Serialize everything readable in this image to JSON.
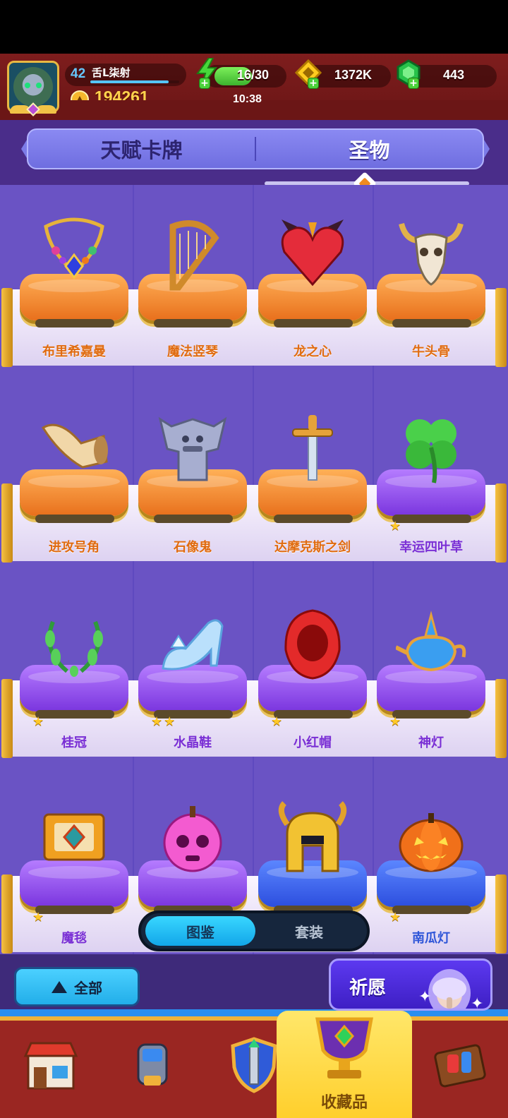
{
  "player": {
    "level": "42",
    "name": "舌L柒射",
    "xp_fraction": 0.88,
    "trophies": "194261"
  },
  "resources": {
    "energy": "16/30",
    "energy_fraction": 0.53,
    "energy_timer": "10:38",
    "gold": "1372K",
    "gems": "443"
  },
  "tabs": {
    "talent": "天赋卡牌",
    "relic": "圣物"
  },
  "relics": [
    {
      "name": "布里希嘉曼",
      "rarity": "orange",
      "stars": 0,
      "icon": "necklace-icon"
    },
    {
      "name": "魔法竖琴",
      "rarity": "orange",
      "stars": 0,
      "icon": "harp-icon"
    },
    {
      "name": "龙之心",
      "rarity": "orange",
      "stars": 0,
      "icon": "heart-icon"
    },
    {
      "name": "牛头骨",
      "rarity": "orange",
      "stars": 0,
      "icon": "bull-skull-icon"
    },
    {
      "name": "进攻号角",
      "rarity": "orange",
      "stars": 0,
      "icon": "horn-icon"
    },
    {
      "name": "石像鬼",
      "rarity": "orange",
      "stars": 0,
      "icon": "gargoyle-icon"
    },
    {
      "name": "达摩克斯之剑",
      "rarity": "orange",
      "stars": 0,
      "icon": "sword-icon"
    },
    {
      "name": "幸运四叶草",
      "rarity": "purple",
      "stars": 1,
      "icon": "clover-icon"
    },
    {
      "name": "桂冠",
      "rarity": "purple",
      "stars": 1,
      "icon": "laurel-icon"
    },
    {
      "name": "水晶鞋",
      "rarity": "purple",
      "stars": 2,
      "icon": "glass-slipper-icon"
    },
    {
      "name": "小红帽",
      "rarity": "purple",
      "stars": 1,
      "icon": "red-hood-icon"
    },
    {
      "name": "神灯",
      "rarity": "purple",
      "stars": 1,
      "icon": "magic-lamp-icon"
    },
    {
      "name": "魔毯",
      "rarity": "purple",
      "stars": 1,
      "icon": "magic-carpet-icon"
    },
    {
      "name": "",
      "rarity": "purple",
      "stars": 0,
      "icon": "poison-apple-icon"
    },
    {
      "name": "",
      "rarity": "blue",
      "stars": 0,
      "icon": "golden-helmet-icon"
    },
    {
      "name": "南瓜灯",
      "rarity": "blue",
      "stars": 1,
      "icon": "pumpkin-icon"
    }
  ],
  "view_toggle": {
    "catalog": "图鉴",
    "sets": "套装"
  },
  "filter": {
    "all_label": "全部"
  },
  "wish": {
    "label": "祈愿"
  },
  "nav": {
    "items": [
      {
        "label": "",
        "icon": "shop-icon"
      },
      {
        "label": "",
        "icon": "armor-icon"
      },
      {
        "label": "",
        "icon": "shield-sword-icon"
      },
      {
        "label": "收藏品",
        "icon": "trophy-cup-icon"
      },
      {
        "label": "",
        "icon": "treasure-map-icon"
      }
    ]
  },
  "colors": {
    "header_bg": "#7e1d1d",
    "grid_bg": "#6a53c4",
    "accent_gold": "#f0b23a",
    "active_blue": "#22aee9"
  }
}
